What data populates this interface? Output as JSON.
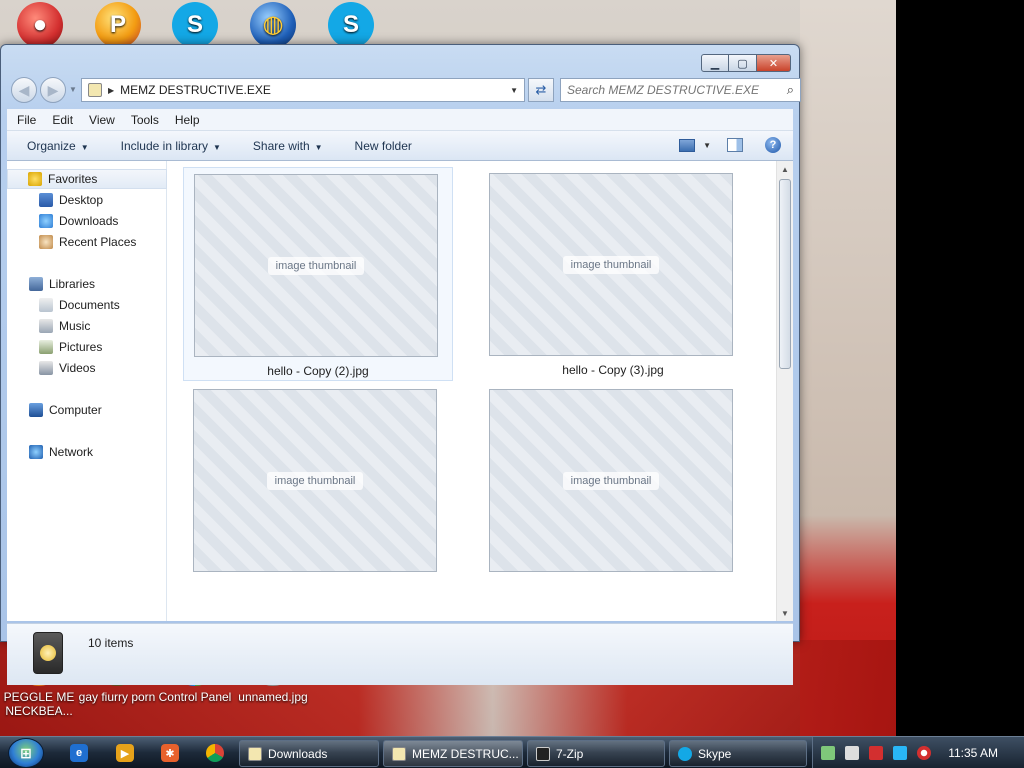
{
  "desktop": {
    "icons": [
      {
        "label": "",
        "icon": "red-button-icon"
      },
      {
        "label": "",
        "icon": "peggle-icon"
      },
      {
        "label": "",
        "icon": "skype-icon"
      },
      {
        "label": "",
        "icon": "globe-icon"
      },
      {
        "label": "",
        "icon": "skype-icon"
      },
      {
        "label": "PEGGLE ME NECKBEA...",
        "icon": "peggle-icon"
      },
      {
        "label": "gay fiurry porn",
        "icon": "box-icon"
      },
      {
        "label": "Control Panel",
        "icon": "control-panel-icon"
      },
      {
        "label": "unnamed.jpg",
        "icon": "image-file-icon"
      }
    ]
  },
  "window": {
    "address": {
      "path": "MEMZ DESTRUCTIVE.EXE"
    },
    "search": {
      "placeholder": "Search MEMZ DESTRUCTIVE.EXE"
    },
    "menu": [
      "File",
      "Edit",
      "View",
      "Tools",
      "Help"
    ],
    "toolbar": {
      "organize": "Organize",
      "include": "Include in library",
      "share": "Share with",
      "new_folder": "New folder"
    },
    "nav": {
      "favorites": "Favorites",
      "desktop": "Desktop",
      "downloads": "Downloads",
      "recent": "Recent Places",
      "libraries": "Libraries",
      "documents": "Documents",
      "music": "Music",
      "pictures": "Pictures",
      "videos": "Videos",
      "computer": "Computer",
      "network": "Network"
    },
    "files": [
      {
        "name": "hello - Copy (2).jpg",
        "selected": true
      },
      {
        "name": "hello - Copy (3).jpg",
        "selected": false
      },
      {
        "name": "",
        "selected": false
      },
      {
        "name": "",
        "selected": false
      }
    ],
    "thumbnail_placeholder": "image thumbnail",
    "details": {
      "count": "10 items"
    }
  },
  "taskbar": {
    "tasks": [
      {
        "label": "Downloads",
        "icon": "folder-icon"
      },
      {
        "label": "MEMZ DESTRUC...",
        "icon": "folder-icon"
      },
      {
        "label": "7-Zip",
        "icon": "7zip-icon"
      },
      {
        "label": "Skype",
        "icon": "skype-icon"
      }
    ],
    "clock": "11:35 AM"
  },
  "colors": {
    "accent": "#2a5ea6",
    "skype": "#13a8e6",
    "close": "#c9432b"
  }
}
